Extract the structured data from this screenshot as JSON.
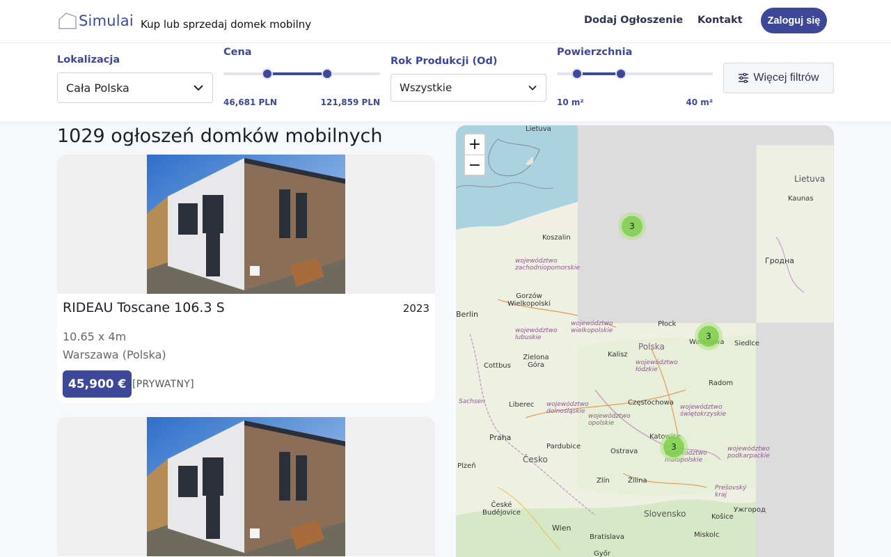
{
  "header": {
    "logo_text": "Simulai",
    "tagline": "Kup lub sprzedaj domek mobilny",
    "nav_add": "Dodaj Ogłoszenie",
    "nav_contact": "Kontakt",
    "login": "Zaloguj się"
  },
  "filters": {
    "location_label": "Lokalizacja",
    "location_value": "Cała Polska",
    "price_label": "Cena",
    "price_min": "46,681 PLN",
    "price_max": "121,859 PLN",
    "price_fill_fraction": [
      0.28,
      0.66
    ],
    "year_label": "Rok Produkcji (Od)",
    "year_value": "Wszystkie",
    "area_label": "Powierzchnia",
    "area_min": "10 m²",
    "area_max": "40 m²",
    "area_fill_fraction": [
      0.13,
      0.41
    ],
    "more_filters": "Więcej filtrów"
  },
  "listings": {
    "count_title": "1029 ogłoszeń domków mobilnych",
    "items": [
      {
        "title": "RIDEAU Toscane 106.3 S",
        "year": "2023",
        "dimensions": "10.65 x 4m",
        "location": "Warszawa (Polska)",
        "price": "45,900 €",
        "seller": "[PRYWATNY]"
      },
      {
        "title": "",
        "year": "",
        "dimensions": "",
        "location": "",
        "price": "",
        "seller": ""
      }
    ]
  },
  "map": {
    "zoom_in": "+",
    "zoom_out": "−",
    "clusters": [
      "3",
      "3",
      "3"
    ],
    "labels": {
      "lietuva": "Lietuva",
      "kaunas": "Kaunas",
      "grodno": "Гродна",
      "koszalin": "Koszalin",
      "zachodniopomorskie": "województwo zachodniopomorskie",
      "gorzow": "Gorzów Wielkopolski",
      "berlin": "Berlin",
      "wielkopolskie": "województwo wielkopolskie",
      "lubuskie": "województwo lubuskie",
      "plock": "Płock",
      "warszawa": "Warszawa",
      "polska": "Polska",
      "kalisz": "Kalisz",
      "lodzkie": "województwo łódzkie",
      "zielona": "Zielona Góra",
      "cottbus": "Cottbus",
      "radom": "Radom",
      "sachsen": "Sachsen",
      "liberec": "Liberec",
      "dolnoslaskie": "województwo dolnośląskie",
      "czestochowa": "Częstochowa",
      "swietokrzyskie": "województwo świętokrzyskie",
      "opolskie": "województwo opolskie",
      "praha": "Praha",
      "pardubice": "Pardubice",
      "katowice": "Katowice",
      "ostrava": "Ostrava",
      "malopolskie": "województwo małopolskie",
      "podkarpackie": "województwo podkarpackie",
      "cesko": "Česko",
      "plzen": "Plzeň",
      "zlin": "Zlín",
      "zilina": "Žilina",
      "presov": "Prešovský kraj",
      "ceske": "České Budějovice",
      "slovensko": "Slovensko",
      "kosice": "Košice",
      "uzhorod": "Ужгород",
      "wien": "Wien",
      "bratislava": "Bratislava",
      "miskolc": "Miskolc",
      "gyor": "Győr",
      "siedlce": "Siedlce"
    }
  }
}
